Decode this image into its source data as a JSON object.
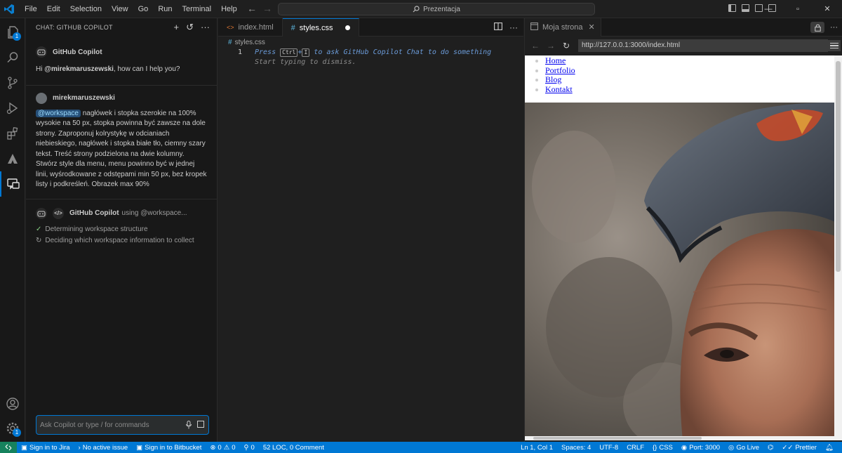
{
  "menu": [
    "File",
    "Edit",
    "Selection",
    "View",
    "Go",
    "Run",
    "Terminal",
    "Help"
  ],
  "command_center": "Prezentacja",
  "window_controls": [
    "—",
    "▫",
    "✕"
  ],
  "activity_badges": {
    "explorer": "1",
    "settings": "1"
  },
  "chat": {
    "header": "CHAT: GITHUB COPILOT",
    "bot_name": "GitHub Copilot",
    "greeting_prefix": "Hi ",
    "greeting_user": "@mirekmaruszewski",
    "greeting_suffix": ", how can I help you?",
    "user_name": "mirekmaruszewski",
    "mention": "@workspace",
    "user_message": "nagłówek i stopka szerokie na 100% wysokie na 50 px, stopka powinna być zawsze na dole strony. Zaproponuj kolrystykę w odcianiach niebieskiego, nagłówek i stopka białe tło, ciemny szary tekst. Treść strony podzielona na dwie kolumny. Stwórz style dla menu, menu powinno być w jednej linii, wyśrodkowane z odstępami min 50 px, bez kropek listy i podkreśleń. Obrazek max 90%",
    "response_name": "GitHub Copilot",
    "response_using": "using @workspace...",
    "step_done": "Determining workspace structure",
    "step_running": "Deciding which workspace information to collect",
    "input_placeholder": "Ask Copilot or type / for commands"
  },
  "editor": {
    "tabs": [
      {
        "label": "index.html",
        "icon": "<>"
      },
      {
        "label": "styles.css",
        "icon": "#"
      }
    ],
    "breadcrumb": "styles.css",
    "line_number": "1",
    "hint_press": "Press",
    "hint_ctrl": "Ctrl",
    "hint_plus": "+",
    "hint_i": "I",
    "hint_rest": "to ask GitHub Copilot Chat to do something",
    "hint_line2": "Start typing to dismiss."
  },
  "preview": {
    "tab_label": "Moja strona",
    "url": "http://127.0.0.1:3000/index.html",
    "nav_links": [
      "Home",
      "Portfolio",
      "Blog",
      "Kontakt"
    ]
  },
  "status": {
    "jira": "Sign in to Jira",
    "issue": "No active issue",
    "bitbucket": "Sign in to Bitbucket",
    "errors": "0",
    "warnings": "0",
    "ports": "0",
    "loc": "52 LOC, 0 Comment",
    "position": "Ln 1, Col 1",
    "spaces": "Spaces: 4",
    "encoding": "UTF-8",
    "eol": "CRLF",
    "language": "CSS",
    "port": "Port: 3000",
    "golive": "Go Live",
    "prettier": "Prettier"
  },
  "colors": {
    "accent": "#0078d4",
    "statusbar": "#0078d4",
    "remote": "#16825d"
  }
}
